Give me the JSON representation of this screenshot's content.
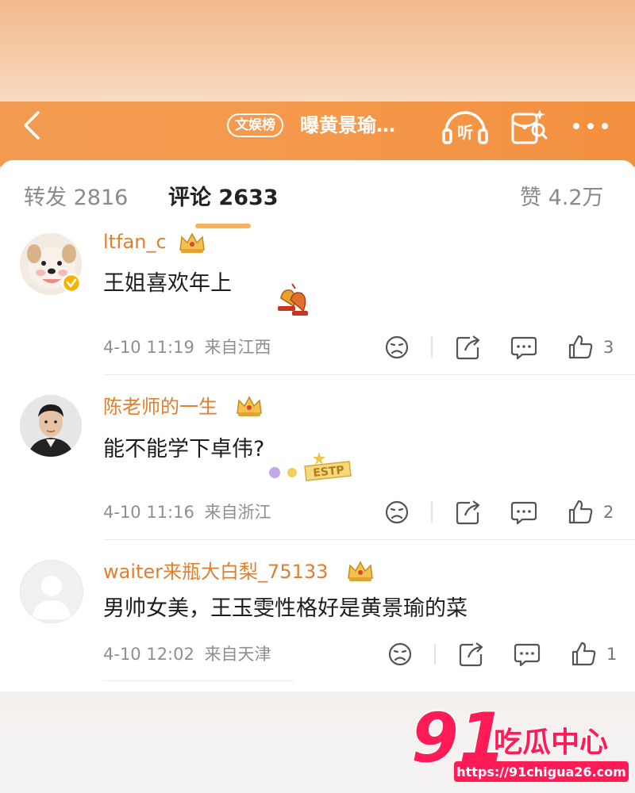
{
  "header": {
    "topic_tag": "文娱榜",
    "title": "曝黄景瑜…",
    "listen_label": "听"
  },
  "tabs": {
    "repost": {
      "label": "转发",
      "count": "2816"
    },
    "comment": {
      "label": "评论",
      "count": "2633"
    },
    "likes": {
      "label": "赞",
      "count": "4.2万"
    }
  },
  "comments": [
    {
      "user": "ltfan_c",
      "text": "王姐喜欢年上",
      "time": "4-10 11:19",
      "location": "来自江西",
      "likes": "3"
    },
    {
      "user": "陈老师的一生",
      "text": "能不能学下卓伟?",
      "time": "4-10 11:16",
      "location": "来自浙江",
      "likes": "2",
      "sticker_text": "ESTP"
    },
    {
      "user": "waiter来瓶大白梨_75133",
      "text": "男帅女美，王玉雯性格好是黄景瑜的菜",
      "time": "4-10 12:02",
      "location": "来自天津",
      "likes": "1"
    }
  ],
  "watermark": {
    "brand": "91吃瓜中心",
    "url": "https://91chigua26.com"
  },
  "colors": {
    "accent": "#f39a52",
    "username": "#e07f2e",
    "watermark": "#ff1c56"
  },
  "icons": [
    "back-arrow-icon",
    "listen-icon",
    "red-packet-icon",
    "more-icon",
    "crown-icon",
    "dislike-icon",
    "share-icon",
    "comment-icon",
    "like-icon"
  ]
}
